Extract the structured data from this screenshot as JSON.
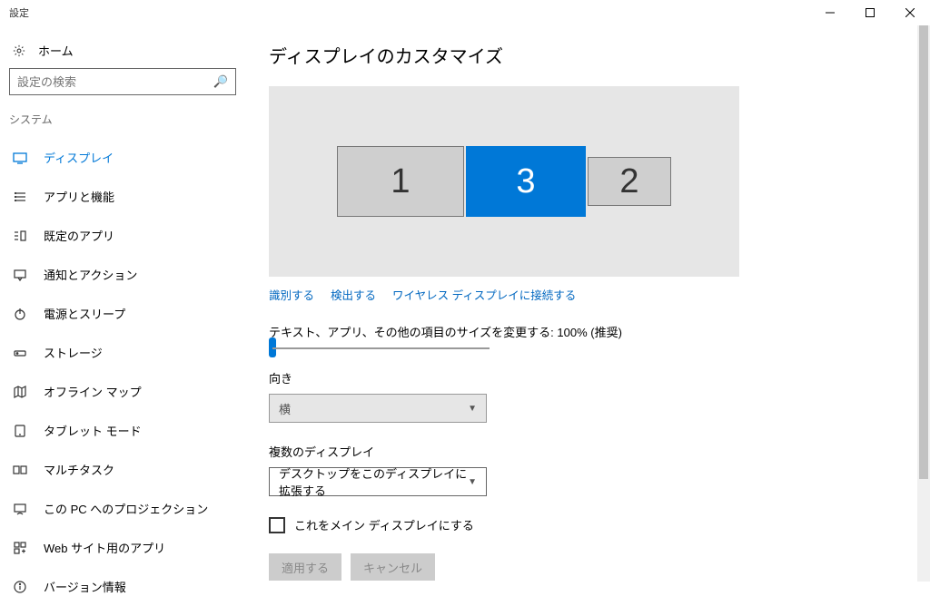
{
  "window": {
    "title": "設定"
  },
  "sidebar": {
    "home": "ホーム",
    "search_placeholder": "設定の検索",
    "section": "システム",
    "items": [
      {
        "id": "display",
        "label": "ディスプレイ"
      },
      {
        "id": "apps",
        "label": "アプリと機能"
      },
      {
        "id": "default-apps",
        "label": "既定のアプリ"
      },
      {
        "id": "notifications",
        "label": "通知とアクション"
      },
      {
        "id": "power",
        "label": "電源とスリープ"
      },
      {
        "id": "storage",
        "label": "ストレージ"
      },
      {
        "id": "offline-maps",
        "label": "オフライン マップ"
      },
      {
        "id": "tablet",
        "label": "タブレット モード"
      },
      {
        "id": "multitask",
        "label": "マルチタスク"
      },
      {
        "id": "projection",
        "label": "この PC へのプロジェクション"
      },
      {
        "id": "web-apps",
        "label": "Web サイト用のアプリ"
      },
      {
        "id": "about",
        "label": "バージョン情報"
      }
    ]
  },
  "main": {
    "heading": "ディスプレイのカスタマイズ",
    "monitors": {
      "m1": "1",
      "m2": "2",
      "m3": "3"
    },
    "links": {
      "identify": "識別する",
      "detect": "検出する",
      "wireless": "ワイヤレス ディスプレイに接続する"
    },
    "scaling_label": "テキスト、アプリ、その他の項目のサイズを変更する: 100% (推奨)",
    "orientation": {
      "label": "向き",
      "value": "横"
    },
    "multiple": {
      "label": "複数のディスプレイ",
      "value": "デスクトップをこのディスプレイに拡張する"
    },
    "main_display_checkbox": "これをメイン ディスプレイにする",
    "apply_btn": "適用する",
    "cancel_btn": "キャンセル"
  }
}
